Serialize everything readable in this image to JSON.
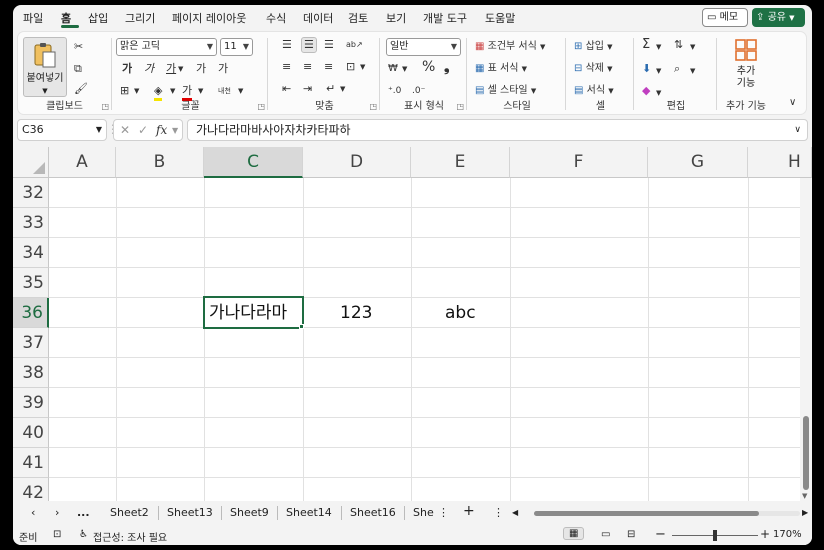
{
  "menu": {
    "tabs": [
      "파일",
      "홈",
      "삽입",
      "그리기",
      "페이지 레이아웃",
      "수식",
      "데이터",
      "검토",
      "보기",
      "개발 도구",
      "도움말"
    ],
    "active_tab": "홈",
    "memo_label": "메모",
    "share_label": "공유"
  },
  "ribbon": {
    "clipboard": {
      "label": "클립보드",
      "paste_label": "붙여넣기"
    },
    "font": {
      "label": "글꼴",
      "font_name": "맑은 고딕",
      "font_size": "11",
      "bold": "가",
      "italic": "가",
      "underline": "가",
      "grow": "가",
      "shrink": "가",
      "font_color_glyph": "가",
      "phonetic": "내천"
    },
    "alignment": {
      "label": "맞춤"
    },
    "number": {
      "label": "표시 형식",
      "format": "일반"
    },
    "styles": {
      "label": "스타일",
      "conditional": "조건부 서식",
      "table": "표 서식",
      "cell_styles": "셀 스타일"
    },
    "cells": {
      "label": "셀",
      "insert": "삽입",
      "delete": "삭제",
      "format": "서식"
    },
    "editing": {
      "label": "편집"
    },
    "addins": {
      "label": "추가 기능",
      "button": "추가\n기능"
    }
  },
  "formula_bar": {
    "name_box": "C36",
    "content": "가나다라마바사아자차카타파하"
  },
  "grid": {
    "columns": [
      "A",
      "B",
      "C",
      "D",
      "E",
      "F",
      "G",
      "H"
    ],
    "selected_column": "C",
    "rows": [
      "32",
      "33",
      "34",
      "35",
      "36",
      "37",
      "38",
      "39",
      "40",
      "41",
      "42"
    ],
    "selected_row": "36",
    "cells": {
      "C36": "가나다라마",
      "D36": "123",
      "E36": "abc"
    }
  },
  "sheets": {
    "tabs": [
      "Sheet2",
      "Sheet13",
      "Sheet9",
      "Sheet14",
      "Sheet16",
      "She"
    ],
    "ellipsis": "..."
  },
  "status": {
    "ready": "준비",
    "accessibility": "접근성: 조사 필요",
    "zoom": "170%"
  }
}
